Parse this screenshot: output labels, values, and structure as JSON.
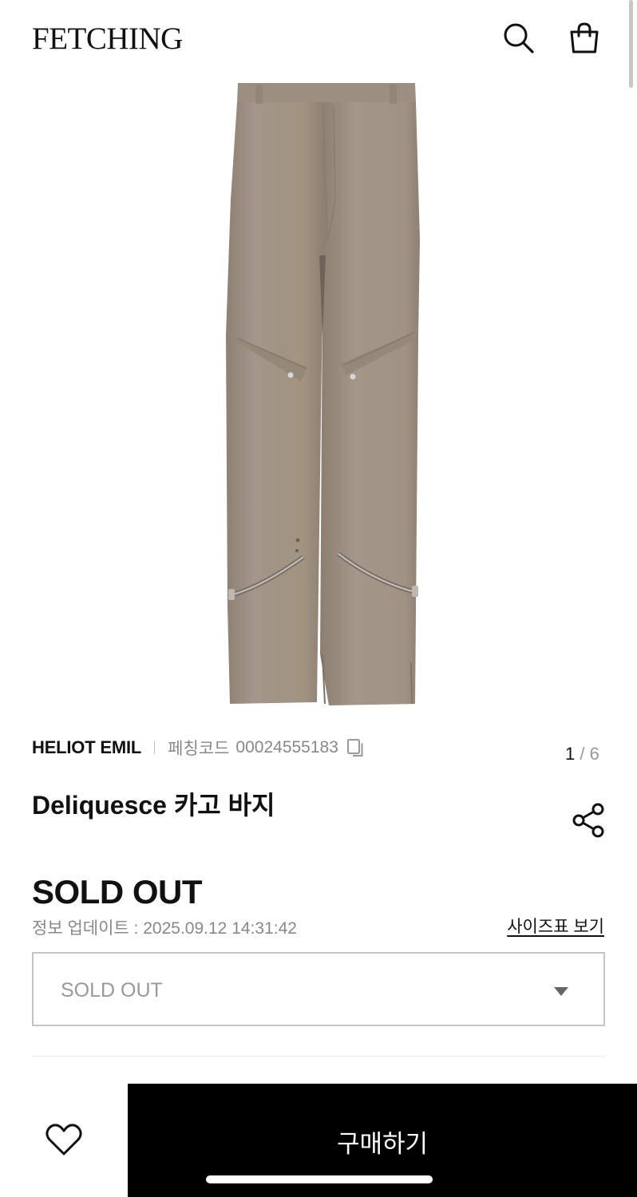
{
  "header": {
    "logo": "FETCHING",
    "search_icon": "search-icon",
    "bag_icon": "shopping-bag-icon"
  },
  "gallery": {
    "current": "1",
    "separator": " / ",
    "total": "6",
    "product_color": "#a09283"
  },
  "product": {
    "brand": "HELIOT EMIL",
    "code_label": "페칭코드",
    "code": "00024555183",
    "copy_icon": "copy-icon",
    "title": "Deliquesce 카고 바지",
    "share_icon": "share-icon"
  },
  "pricing": {
    "status": "SOLD OUT",
    "update_text": "정보 업데이트 : 2025.09.12 14:31:42",
    "size_chart_link": "사이즈표 보기"
  },
  "option_select": {
    "value": "SOLD OUT",
    "caret_icon": "caret-down-icon"
  },
  "bottom_bar": {
    "wishlist_icon": "heart-icon",
    "buy_label": "구매하기",
    "buy_color": "#000000"
  }
}
